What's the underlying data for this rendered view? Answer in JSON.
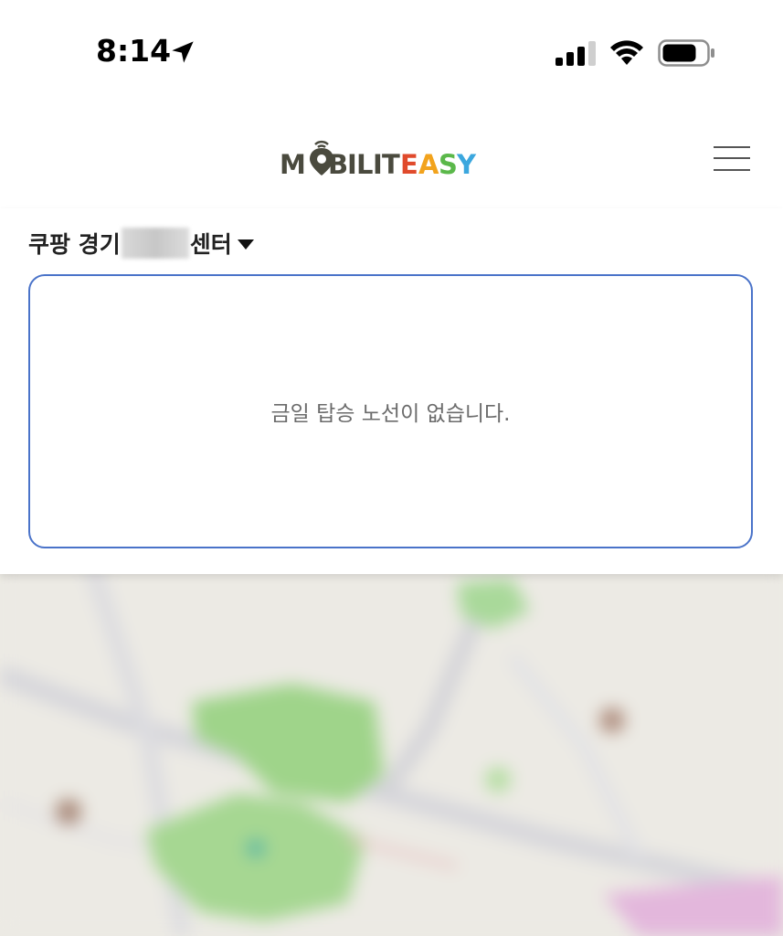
{
  "status_bar": {
    "time": "8:14",
    "icons": [
      "location-arrow-icon",
      "cellular-signal-icon",
      "wifi-icon",
      "battery-icon"
    ]
  },
  "header": {
    "logo": {
      "letters": [
        {
          "ch": "M",
          "color": "#4a4a3e"
        },
        {
          "ch": "O",
          "color": "#4a4a3e"
        },
        {
          "ch": "B",
          "color": "#4a4a3e"
        },
        {
          "ch": "I",
          "color": "#4a4a3e"
        },
        {
          "ch": "L",
          "color": "#4a4a3e"
        },
        {
          "ch": "I",
          "color": "#4a4a3e"
        },
        {
          "ch": "T",
          "color": "#4a4a3e"
        },
        {
          "ch": "E",
          "color": "#e04a2c"
        },
        {
          "ch": "A",
          "color": "#f2a31d"
        },
        {
          "ch": "S",
          "color": "#5bb84a"
        },
        {
          "ch": "Y",
          "color": "#3ba7de"
        }
      ]
    },
    "menu_icon": "hamburger-menu-icon"
  },
  "center_selector": {
    "prefix": "쿠팡 경기",
    "suffix": "센터"
  },
  "routes": {
    "empty_message": "금일 탑승 노선이 없습니다."
  },
  "colors": {
    "accent_border": "#4a73c9",
    "text_dark": "#222222",
    "text_muted": "#6b6b6b",
    "map_green": "#9fd48a",
    "map_base": "#eceae4"
  }
}
